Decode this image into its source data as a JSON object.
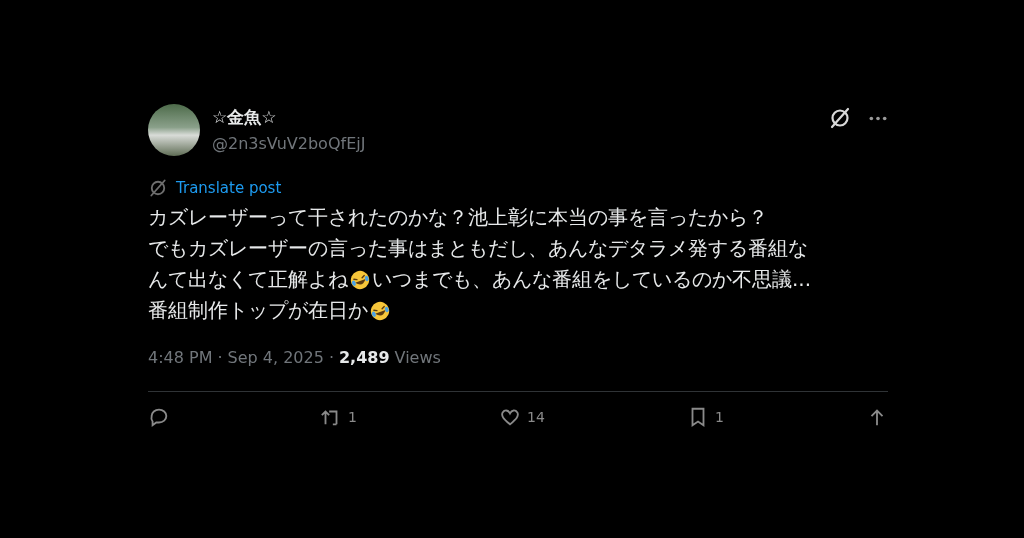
{
  "author": {
    "name": "☆金魚☆",
    "handle": "@2n3sVuV2boQfEjJ"
  },
  "translate": {
    "label": "Translate post"
  },
  "post": {
    "paragraphs": [
      [
        {
          "kind": "text",
          "text": "カズレーザーって干されたのかな？池上彰に本当の事を言ったから？"
        }
      ],
      [
        {
          "kind": "text",
          "text": "でもカズレーザーの言った事はまともだし、あんなデタラメ発する番組な"
        }
      ],
      [
        {
          "kind": "text",
          "text": "んて出なくて正解よね"
        },
        {
          "kind": "emoji"
        },
        {
          "kind": "text",
          "text": "いつまでも、あんな番組をしているのか不思議..."
        }
      ],
      [
        {
          "kind": "text",
          "text": "番組制作トップが在日か"
        },
        {
          "kind": "emoji"
        }
      ]
    ]
  },
  "meta": {
    "separator": "·",
    "time": "4:48 PM",
    "date": "Sep 4, 2025",
    "views_count": "2,489",
    "views_label": "Views"
  },
  "actions": [
    {
      "kind": "reply"
    },
    {
      "kind": "repost",
      "count": "1"
    },
    {
      "kind": "like",
      "count": "14"
    },
    {
      "kind": "bookmark",
      "count": "1"
    },
    {
      "kind": "share"
    }
  ]
}
